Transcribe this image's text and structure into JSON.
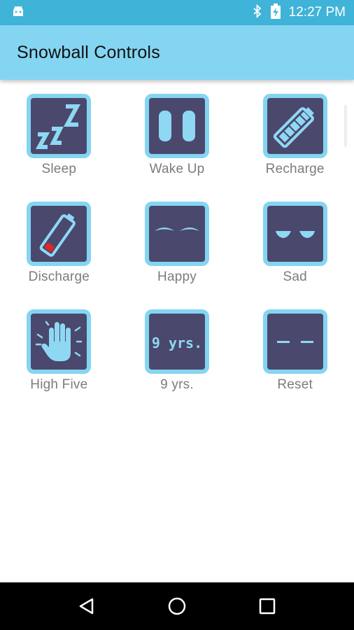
{
  "status_bar": {
    "time": "12:27 PM",
    "icons": [
      "android-icon",
      "bluetooth-icon",
      "battery-charging-icon"
    ]
  },
  "app_bar": {
    "title": "Snowball Controls"
  },
  "controls": [
    {
      "label": "Sleep",
      "icon": "sleep-zzz-icon"
    },
    {
      "label": "Wake Up",
      "icon": "open-eyes-icon"
    },
    {
      "label": "Recharge",
      "icon": "full-battery-icon"
    },
    {
      "label": "Discharge",
      "icon": "low-battery-icon"
    },
    {
      "label": "Happy",
      "icon": "happy-eyes-icon"
    },
    {
      "label": "Sad",
      "icon": "sad-eyes-icon"
    },
    {
      "label": "High Five",
      "icon": "hand-icon"
    },
    {
      "label": "9 yrs.",
      "icon": "age-display-icon",
      "display_text": "9 yrs."
    },
    {
      "label": "Reset",
      "icon": "reset-dashes-icon"
    }
  ],
  "nav_bar": {
    "buttons": [
      "back-icon",
      "home-icon",
      "recents-icon"
    ]
  },
  "colors": {
    "status_bar": "#3fb3d8",
    "app_bar": "#84d5f2",
    "tile_frame": "#84d5f2",
    "tile_face": "#4a486d",
    "glyph": "#8fd8f4",
    "battery_low": "#e52521",
    "label": "#7c7c7c"
  }
}
